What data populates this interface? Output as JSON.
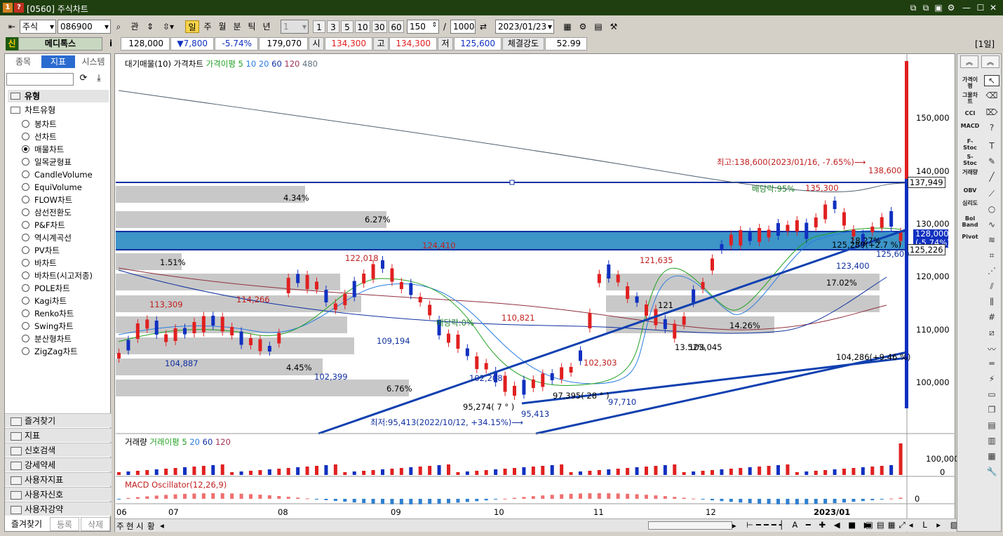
{
  "window": {
    "title": "[0560] 주식차트",
    "badge1": "1",
    "badge2": "?",
    "buttons": [
      "⧉",
      "⧉",
      "▣",
      "⚙",
      "—",
      "☐",
      "✕"
    ]
  },
  "toolbar": {
    "market": "주식",
    "code": "086900",
    "gwan": "관",
    "periods": [
      "일",
      "주",
      "월",
      "분",
      "틱",
      "년"
    ],
    "interval": "1",
    "intervals": [
      "1",
      "3",
      "5",
      "10",
      "30",
      "60"
    ],
    "count": "150",
    "slash": "/",
    "max": "1000",
    "date": "2023/01/23"
  },
  "quote": {
    "sin": "신",
    "name": "메디톡스",
    "info": "i",
    "price": "128,000",
    "change": "▼7,800",
    "pct": "-5.74%",
    "volume": "179,070",
    "open_l": "시",
    "open": "134,300",
    "high_l": "고",
    "high": "134,300",
    "low_l": "저",
    "low": "125,600",
    "str_l": "체결강도",
    "str": "52.99",
    "unit": "[1일]"
  },
  "left_panel": {
    "tabs": [
      "종목",
      "지표",
      "시스템"
    ],
    "category": "유형",
    "subcategory": "차트유형",
    "chart_types": [
      "봉차트",
      "선차트",
      "매물차트",
      "일목균형표",
      "CandleVolume",
      "EquiVolume",
      "FLOW차트",
      "삼선전환도",
      "P&F차트",
      "역시계곡선",
      "PV차트",
      "바차트",
      "바차트(시고저종)",
      "POLE차트",
      "Kagi차트",
      "Renko차트",
      "Swing차트",
      "분산형차트",
      "ZigZag차트"
    ],
    "selected": "매물차트",
    "groups": [
      "즐겨찾기",
      "지표",
      "신호검색",
      "강세약세",
      "사용자지표",
      "사용자신호",
      "사용자강약"
    ],
    "footer": [
      "즐겨찾기",
      "등록",
      "삭제"
    ]
  },
  "legend": {
    "main": [
      "대기매물(10)",
      "가격차트",
      "가격이평 5",
      "10",
      "20",
      "60",
      "120",
      "480"
    ],
    "volume": [
      "거래량",
      "거래이평 5",
      "20",
      "60",
      "120"
    ],
    "macd": "MACD Oscillator(12,26,9)"
  },
  "price_axis": {
    "ticks": [
      "150,000",
      "140,000",
      "130,000",
      "120,000",
      "110,000",
      "100,000"
    ],
    "box_hi": "137,949",
    "box_cur": "128,000",
    "box_cur2": "(-5.74%)",
    "box_low": "125,226"
  },
  "volume_axis": {
    "ticks": [
      "100,000",
      "0"
    ]
  },
  "macd_axis": {
    "ticks": [
      "0"
    ]
  },
  "x_axis": {
    "labels": [
      "06",
      "07",
      "08",
      "09",
      "10",
      "11",
      "12",
      "2023/01"
    ]
  },
  "bottom_tabs": [
    "주",
    "현",
    "시",
    "황"
  ],
  "annotations": {
    "high": "최고:138,600(2023/01/16, -7.65%)⟶",
    "low": "최저:95,413(2022/10/12, +34.15%)⟶",
    "div1": "배당락:95%",
    "div1v": "135,300",
    "div2": "배당락:0%",
    "p138600": "138,600",
    "p124410": "124,410",
    "p122018": "122,018",
    "p121635": "121,635",
    "p113309": "113,309",
    "p114266": "114,266",
    "p110821": "110,821",
    "p109194": "109,194",
    "p104887": "104,887",
    "p102399": "102,399",
    "p102208": "102,208",
    "p102303": "102,303",
    "p97710": "97,710",
    "p95413": "95,413",
    "p95274": "95,274(  7 ° )",
    "p97395": "97,395(  28 ° )",
    "p123400": "123,400",
    "p125600": "125,600",
    "p104286": "104,286(+9.46 %)",
    "p103045": "103,045",
    "p121": "121",
    "p125289": "125,289(+2.7 %)",
    "vp": [
      "4.34%",
      "6.27%",
      "1.51%",
      "4.45%",
      "6.76%",
      "17.02%",
      "14.26%",
      "13.52%",
      "18.27%"
    ]
  },
  "colors": {
    "up": "#e02020",
    "down": "#1030c0",
    "band": "#3d95c8",
    "gray": "#c8c8c8"
  },
  "right_tools": [
    "가격이평",
    "그물차트",
    "CCI",
    "MACD",
    "F-Stoc",
    "S-Stoc",
    "거래량",
    "OBV",
    "심리도",
    "Bol Band",
    "Pivot"
  ]
}
